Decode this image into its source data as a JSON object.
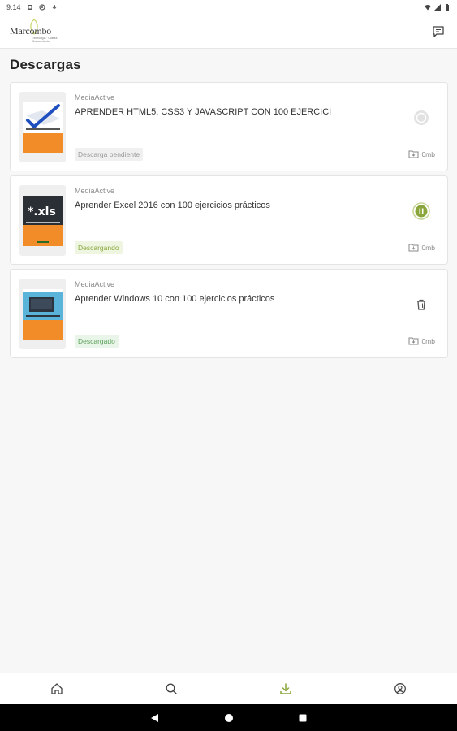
{
  "status_bar": {
    "time": "9:14"
  },
  "header": {
    "logo_text": "Marcombo",
    "logo_subtitle": "Tecnología · Cultura · Conocimiento"
  },
  "page": {
    "title": "Descargas"
  },
  "downloads": [
    {
      "publisher": "MediaActive",
      "title": "APRENDER HTML5, CSS3 Y JAVASCRIPT CON 100 EJERCICI",
      "status": "Descarga pendiente",
      "action_icon": "pending-icon",
      "size": "0mb",
      "cover_accent": "#f28c28"
    },
    {
      "publisher": "MediaActive",
      "title": "Aprender Excel 2016 con 100 ejercicios prácticos",
      "status": "Descargando",
      "action_icon": "pause-icon",
      "size": "0mb",
      "cover_accent": "#f28c28"
    },
    {
      "publisher": "MediaActive",
      "title": "Aprender Windows 10 con 100 ejercicios prácticos",
      "status": "Descargado",
      "action_icon": "trash-icon",
      "size": "0mb",
      "cover_accent": "#f28c28"
    }
  ],
  "bottom_nav": {
    "items": [
      {
        "icon": "home-icon"
      },
      {
        "icon": "search-icon"
      },
      {
        "icon": "download-icon",
        "active": true
      },
      {
        "icon": "profile-icon"
      }
    ]
  },
  "colors": {
    "accent": "#8aa63a",
    "cover_orange": "#f28c28"
  }
}
